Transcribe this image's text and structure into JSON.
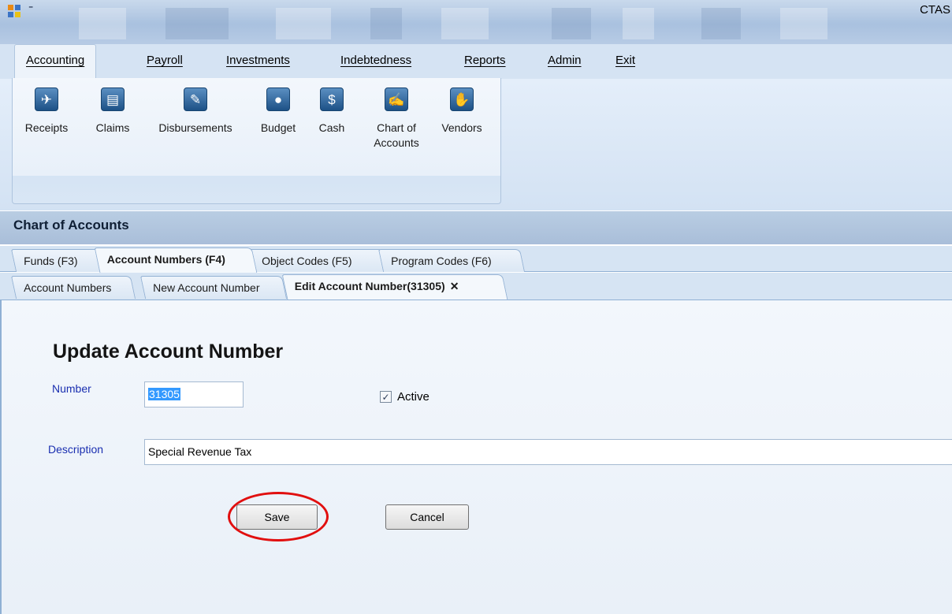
{
  "window": {
    "title": "CTAS",
    "qat_arrow": "⁼"
  },
  "ribbon": {
    "tabs": [
      {
        "label": "Accounting",
        "active": true
      },
      {
        "label": "Payroll"
      },
      {
        "label": "Investments"
      },
      {
        "label": "Indebtedness"
      },
      {
        "label": "Reports"
      },
      {
        "label": "Admin"
      },
      {
        "label": "Exit"
      }
    ],
    "buttons": [
      {
        "label": "Receipts",
        "icon": "receipts-icon",
        "glyph": "✈"
      },
      {
        "label": "Claims",
        "icon": "claims-icon",
        "glyph": "▤"
      },
      {
        "label": "Disbursements",
        "icon": "disbursements-icon",
        "glyph": "✎"
      },
      {
        "label": "Budget",
        "icon": "piggy-bank-icon",
        "glyph": "●"
      },
      {
        "label": "Cash",
        "icon": "cash-icon",
        "glyph": "$"
      },
      {
        "label": "Chart of Accounts",
        "line1": "Chart of",
        "line2": "Accounts",
        "icon": "chart-of-accounts-icon",
        "glyph": "✍"
      },
      {
        "label": "Vendors",
        "icon": "handshake-icon",
        "glyph": "✋"
      }
    ]
  },
  "section": {
    "title": "Chart of Accounts"
  },
  "tabs_level1": [
    {
      "label": "Funds (F3)"
    },
    {
      "label": "Account Numbers (F4)",
      "active": true
    },
    {
      "label": "Object Codes (F5)"
    },
    {
      "label": "Program Codes (F6)"
    }
  ],
  "tabs_level2": [
    {
      "label": "Account Numbers"
    },
    {
      "label": "New Account Number"
    },
    {
      "label": "Edit Account Number(31305)",
      "active": true,
      "close_glyph": "✕"
    }
  ],
  "form": {
    "title": "Update Account Number",
    "number_label": "Number",
    "number_value": "31305",
    "active_label": "Active",
    "active_checked": true,
    "check_glyph": "✓",
    "description_label": "Description",
    "description_value": "Special Revenue Tax",
    "save_label": "Save",
    "cancel_label": "Cancel"
  },
  "colors": {
    "label_blue": "#1a2fb0",
    "callout_red": "#e10f0f",
    "icon_blue": "#1d5186",
    "selection": "#3399ff"
  }
}
